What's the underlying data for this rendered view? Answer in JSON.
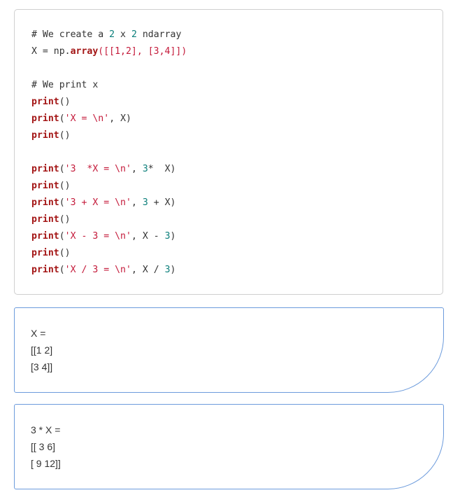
{
  "code_cell": {
    "lines": [
      [
        {
          "t": "cm",
          "v": "# We create a "
        },
        {
          "t": "nm",
          "v": "2"
        },
        {
          "t": "cm",
          "v": " x "
        },
        {
          "t": "nm",
          "v": "2"
        },
        {
          "t": "cm",
          "v": " ndarray"
        }
      ],
      [
        {
          "t": "pn",
          "v": "X = np."
        },
        {
          "t": "kw",
          "v": "array"
        },
        {
          "t": "br",
          "v": "([[1,2], [3,4]])"
        }
      ],
      [],
      [
        {
          "t": "cm",
          "v": "# We print x"
        }
      ],
      [
        {
          "t": "kw",
          "v": "print"
        },
        {
          "t": "pn",
          "v": "()"
        }
      ],
      [
        {
          "t": "kw",
          "v": "print"
        },
        {
          "t": "pn",
          "v": "("
        },
        {
          "t": "st",
          "v": "'X = \\n'"
        },
        {
          "t": "pn",
          "v": ", X)"
        }
      ],
      [
        {
          "t": "kw",
          "v": "print"
        },
        {
          "t": "pn",
          "v": "()"
        }
      ],
      [],
      [
        {
          "t": "kw",
          "v": "print"
        },
        {
          "t": "pn",
          "v": "("
        },
        {
          "t": "st",
          "v": "'3  *X = \\n'"
        },
        {
          "t": "pn",
          "v": ", "
        },
        {
          "t": "nm",
          "v": "3"
        },
        {
          "t": "pn",
          "v": "*  X)"
        }
      ],
      [
        {
          "t": "kw",
          "v": "print"
        },
        {
          "t": "pn",
          "v": "()"
        }
      ],
      [
        {
          "t": "kw",
          "v": "print"
        },
        {
          "t": "pn",
          "v": "("
        },
        {
          "t": "st",
          "v": "'3 + X = \\n'"
        },
        {
          "t": "pn",
          "v": ", "
        },
        {
          "t": "nm",
          "v": "3"
        },
        {
          "t": "pn",
          "v": " + X)"
        }
      ],
      [
        {
          "t": "kw",
          "v": "print"
        },
        {
          "t": "pn",
          "v": "()"
        }
      ],
      [
        {
          "t": "kw",
          "v": "print"
        },
        {
          "t": "pn",
          "v": "("
        },
        {
          "t": "st",
          "v": "'X - 3 = \\n'"
        },
        {
          "t": "pn",
          "v": ", X - "
        },
        {
          "t": "nm",
          "v": "3"
        },
        {
          "t": "pn",
          "v": ")"
        }
      ],
      [
        {
          "t": "kw",
          "v": "print"
        },
        {
          "t": "pn",
          "v": "()"
        }
      ],
      [
        {
          "t": "kw",
          "v": "print"
        },
        {
          "t": "pn",
          "v": "("
        },
        {
          "t": "st",
          "v": "'X / 3 = \\n'"
        },
        {
          "t": "pn",
          "v": ", X / "
        },
        {
          "t": "nm",
          "v": "3"
        },
        {
          "t": "pn",
          "v": ")"
        }
      ]
    ]
  },
  "outputs": [
    {
      "lines": [
        "X =",
        "[[1 2]",
        "[3 4]]"
      ]
    },
    {
      "lines": [
        "3 * X =",
        "[[ 3 6]",
        "[ 9 12]]"
      ]
    }
  ],
  "colors": {
    "code_border": "#cfcfcf",
    "output_border": "#6c9bdc",
    "keyword": "#a31515",
    "string": "#c41a3a",
    "number": "#0a7e7a",
    "text": "#333333"
  }
}
